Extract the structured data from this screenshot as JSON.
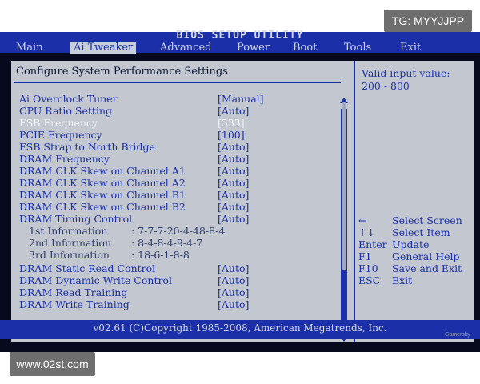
{
  "watermarks": {
    "top": "TG: MYYJJPP",
    "bottom": "www.02st.com"
  },
  "window": {
    "title": "BIOS SETUP UTILITY"
  },
  "tabs": [
    {
      "label": "Main",
      "active": false
    },
    {
      "label": "Ai Tweaker",
      "active": true
    },
    {
      "label": "Advanced",
      "active": false
    },
    {
      "label": "Power",
      "active": false
    },
    {
      "label": "Boot",
      "active": false
    },
    {
      "label": "Tools",
      "active": false
    },
    {
      "label": "Exit",
      "active": false
    }
  ],
  "main": {
    "header": "Configure System Performance Settings",
    "settings": [
      {
        "label": "Ai Overclock Tuner",
        "value": "[Manual]"
      },
      {
        "label": "CPU Ratio Setting",
        "value": "[Auto]"
      },
      {
        "label": "FSB Frequency",
        "value": "[333]",
        "selected": true
      },
      {
        "label": "PCIE Frequency",
        "value": "[100]"
      },
      {
        "label": "FSB Strap to North Bridge",
        "value": "[Auto]"
      },
      {
        "label": "DRAM Frequency",
        "value": "[Auto]"
      },
      {
        "label": "DRAM CLK Skew on Channel A1",
        "value": "[Auto]"
      },
      {
        "label": "DRAM CLK Skew on Channel A2",
        "value": "[Auto]"
      },
      {
        "label": "DRAM CLK Skew on Channel B1",
        "value": "[Auto]"
      },
      {
        "label": "DRAM CLK Skew on Channel B2",
        "value": "[Auto]"
      },
      {
        "label": "DRAM Timing Control",
        "value": "[Auto]"
      }
    ],
    "info_lines": [
      {
        "label": "1st Information",
        "value": ": 7-7-7-20-4-48-8-4"
      },
      {
        "label": "2nd Information",
        "value": ": 8-4-8-4-9-4-7"
      },
      {
        "label": "3rd Information",
        "value": ": 18-6-1-8-8"
      }
    ],
    "settings2": [
      {
        "label": "DRAM Static Read Control",
        "value": "[Auto]"
      },
      {
        "label": "DRAM Dynamic Write Control",
        "value": "[Auto]"
      },
      {
        "label": "DRAM Read Training",
        "value": "[Auto]"
      },
      {
        "label": "DRAM Write Training",
        "value": "[Auto]"
      }
    ]
  },
  "side": {
    "help_line1": "Valid input value:",
    "help_line2": "200 - 800",
    "keys": [
      {
        "key": "←",
        "desc": "Select Screen"
      },
      {
        "key": "↑↓",
        "desc": "Select Item"
      },
      {
        "key": "Enter",
        "desc": "Update"
      },
      {
        "key": "F1",
        "desc": "General Help"
      },
      {
        "key": "F10",
        "desc": "Save and Exit"
      },
      {
        "key": "ESC",
        "desc": "Exit"
      }
    ]
  },
  "footer": {
    "copyright": "v02.61 (C)Copyright 1985-2008, American Megatrends, Inc."
  },
  "logo": {
    "text": "Gamersky"
  }
}
